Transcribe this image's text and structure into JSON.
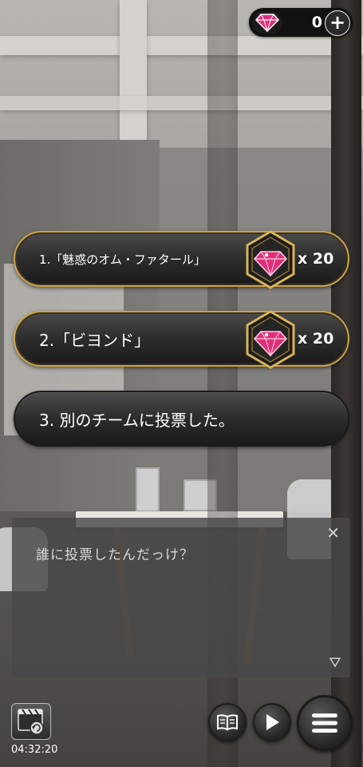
{
  "currency": {
    "gem_count": "0",
    "plus_label": "+"
  },
  "choices": [
    {
      "label": "1.「魅惑のオム・ファタール」",
      "cost": "x 20",
      "premium": true
    },
    {
      "label": "2.「ビヨンド」",
      "cost": "x 20",
      "premium": true
    },
    {
      "label": "3. 別のチームに投票した。",
      "premium": false
    }
  ],
  "dialog": {
    "text": "誰に投票したんだっけ？",
    "close_label": "✕"
  },
  "footer": {
    "time": "04:32:20"
  },
  "colors": {
    "gold_border": "#caa44a",
    "gem_pink": "#e0307a",
    "dialog_bg": "#484848"
  }
}
